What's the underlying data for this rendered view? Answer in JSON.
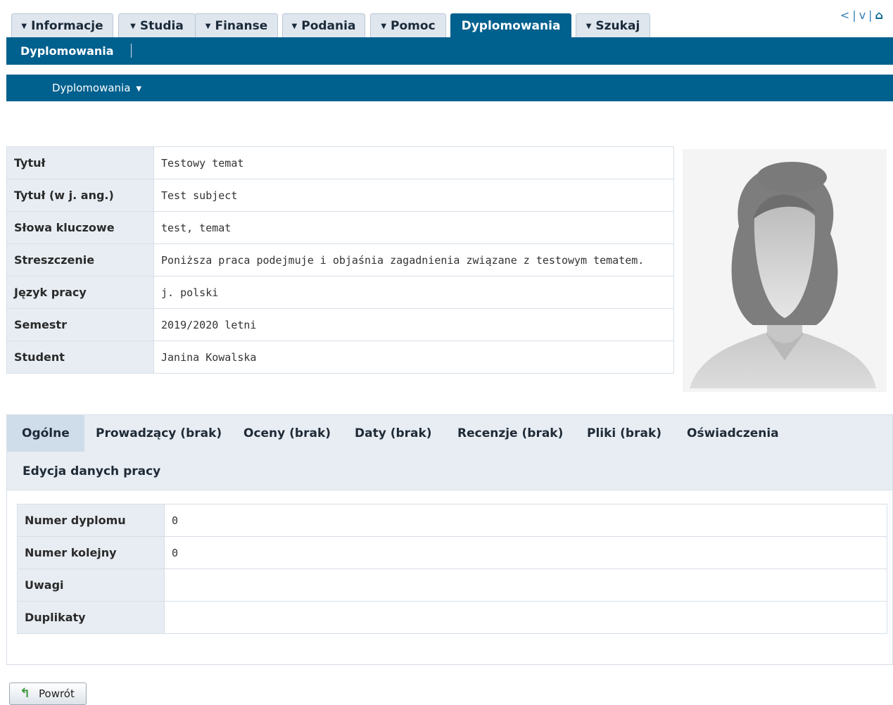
{
  "top_tabs": [
    {
      "label": "Informacje",
      "caret": true
    },
    {
      "label": "Studia",
      "caret": true
    },
    {
      "label": "Finanse",
      "caret": true
    },
    {
      "label": "Podania",
      "caret": true
    },
    {
      "label": "Pomoc",
      "caret": true
    },
    {
      "label": "Dyplomowania",
      "caret": false,
      "active": true
    },
    {
      "label": "Szukaj",
      "caret": true
    }
  ],
  "corner_links": {
    "back": "<",
    "sep1": "|",
    "down": "v",
    "sep2": "|"
  },
  "submenu_bar": {
    "label": "Dyplomowania"
  },
  "section_bar": {
    "label": "Dyplomowania"
  },
  "thesis_info": [
    {
      "key": "Tytuł",
      "value": "Testowy temat"
    },
    {
      "key": "Tytuł (w j. ang.)",
      "value": "Test subject"
    },
    {
      "key": "Słowa kluczowe",
      "value": "test, temat"
    },
    {
      "key": "Streszczenie",
      "value": "Poniższa praca podejmuje i objaśnia zagadnienia związane z testowym tematem."
    },
    {
      "key": "Język pracy",
      "value": "j. polski"
    },
    {
      "key": "Semestr",
      "value": "2019/2020 letni"
    },
    {
      "key": "Student",
      "value": "Janina Kowalska"
    }
  ],
  "detail_tabs": [
    {
      "label": "Ogólne",
      "active": true
    },
    {
      "label": "Prowadzący (brak)"
    },
    {
      "label": "Oceny (brak)"
    },
    {
      "label": "Daty (brak)"
    },
    {
      "label": "Recenzje (brak)"
    },
    {
      "label": "Pliki (brak)"
    },
    {
      "label": "Oświadczenia"
    },
    {
      "label": "Edycja danych pracy"
    }
  ],
  "diploma_info": [
    {
      "key": "Numer dyplomu",
      "value": "0"
    },
    {
      "key": "Numer kolejny",
      "value": "0"
    },
    {
      "key": "Uwagi",
      "value": ""
    },
    {
      "key": "Duplikaty",
      "value": ""
    }
  ],
  "back_button": {
    "label": "Powrót"
  },
  "colors": {
    "primary": "#00608e",
    "label_bg": "#e8edf3",
    "tab_bg": "#dfe6ee"
  }
}
